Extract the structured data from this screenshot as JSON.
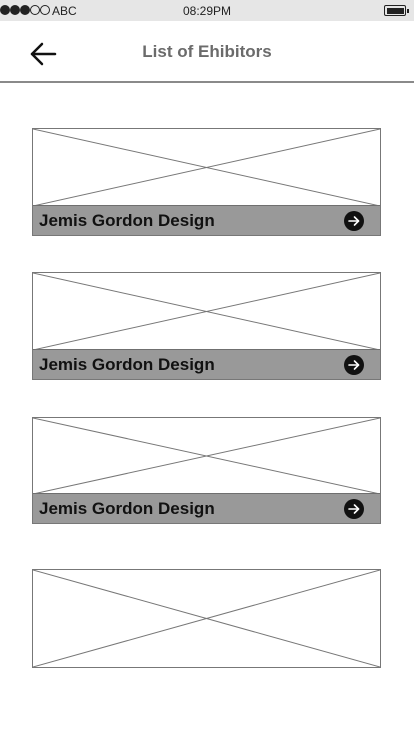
{
  "status_bar": {
    "carrier": "ABC",
    "time": "08:29PM",
    "signal_filled": 3,
    "signal_total": 5
  },
  "header": {
    "title": "List of Ehibitors",
    "back_icon": "arrow-left-icon"
  },
  "exhibitors": [
    {
      "name": "Jemis Gordon Design",
      "action_icon": "arrow-right-circle-icon"
    },
    {
      "name": "Jemis Gordon Design",
      "action_icon": "arrow-right-circle-icon"
    },
    {
      "name": "Jemis Gordon Design",
      "action_icon": "arrow-right-circle-icon"
    },
    {
      "name": ""
    }
  ],
  "colors": {
    "status_bar_bg": "#e6e6e6",
    "title": "#6b6b6b",
    "name_bar": "#999999"
  }
}
